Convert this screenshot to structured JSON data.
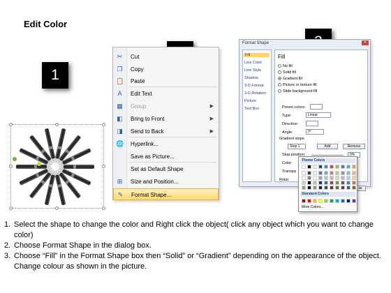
{
  "title": "Edit Color",
  "steps": [
    "1",
    "2",
    "3"
  ],
  "context_menu": {
    "items": [
      {
        "label": "Cut",
        "icon": "scissors-icon",
        "disabled": false,
        "submenu": false
      },
      {
        "label": "Copy",
        "icon": "copy-icon",
        "disabled": false,
        "submenu": false
      },
      {
        "label": "Paste",
        "icon": "paste-icon",
        "disabled": false,
        "submenu": false
      },
      {
        "label": "Edit Text",
        "icon": "edit-text-icon",
        "disabled": false,
        "submenu": false
      },
      {
        "label": "Group",
        "icon": "group-icon",
        "disabled": true,
        "submenu": true
      },
      {
        "label": "Bring to Front",
        "icon": "bring-to-front-icon",
        "disabled": false,
        "submenu": true
      },
      {
        "label": "Send to Back",
        "icon": "send-to-back-icon",
        "disabled": false,
        "submenu": true
      },
      {
        "label": "Hyperlink...",
        "icon": "hyperlink-icon",
        "disabled": false,
        "submenu": false
      },
      {
        "label": "Save as Picture...",
        "icon": "",
        "disabled": false,
        "submenu": false
      },
      {
        "label": "Set as Default Shape",
        "icon": "",
        "disabled": false,
        "submenu": false
      },
      {
        "label": "Size and Position...",
        "icon": "size-position-icon",
        "disabled": false,
        "submenu": false
      },
      {
        "label": "Format Shape...",
        "icon": "format-shape-icon",
        "disabled": false,
        "submenu": false,
        "highlighted": true
      }
    ]
  },
  "format_dialog": {
    "title": "Format Shape",
    "categories": [
      "Fill",
      "Line Color",
      "Line Style",
      "Shadow",
      "3-D Format",
      "3-D Rotation",
      "Picture",
      "Text Box"
    ],
    "selected_category": "Fill",
    "heading": "Fill",
    "fill_options": [
      "No fill",
      "Solid fill",
      "Gradient fill",
      "Picture or texture fill",
      "Slide background fill"
    ],
    "selected_fill": "Gradient fill",
    "preset_colors_label": "Preset colors:",
    "type_label": "Type:",
    "type_value": "Linear",
    "direction_label": "Direction:",
    "angle_label": "Angle:",
    "angle_value": "0°",
    "gradient_stops_label": "Gradient stops",
    "stop_value": "Stop 1",
    "add_label": "Add",
    "remove_label": "Remove",
    "stop_position_label": "Stop position:",
    "stop_position_value": "0%",
    "color_label": "Color:",
    "transparency_label": "Transpa",
    "rotate_label": "Rotat",
    "close_label": "se"
  },
  "color_popup": {
    "theme_label": "Theme Colors",
    "standard_label": "Standard Colors",
    "more_label": "More Colors...",
    "theme_top": [
      "#ffffff",
      "#000000",
      "#eeece1",
      "#1f497d",
      "#4f81bd",
      "#c0504d",
      "#9bbb59",
      "#8064a2",
      "#4bacc6",
      "#f79646"
    ],
    "standard": [
      "#c00000",
      "#ff0000",
      "#ffc000",
      "#ffff00",
      "#92d050",
      "#00b050",
      "#00b0f0",
      "#0070c0",
      "#002060",
      "#7030a0"
    ]
  },
  "instructions": [
    {
      "num": "1.",
      "text": "Select the shape to change the color and Right click the object( click any object which you want to change color)"
    },
    {
      "num": "2.",
      "text": "Choose Format Shape in the dialog box."
    },
    {
      "num": "3.",
      "text": "Choose “Fill” in the Format Shape box then “Solid” or “Gradient” depending on the appearance of the object. Change colour as shown in the picture."
    }
  ]
}
